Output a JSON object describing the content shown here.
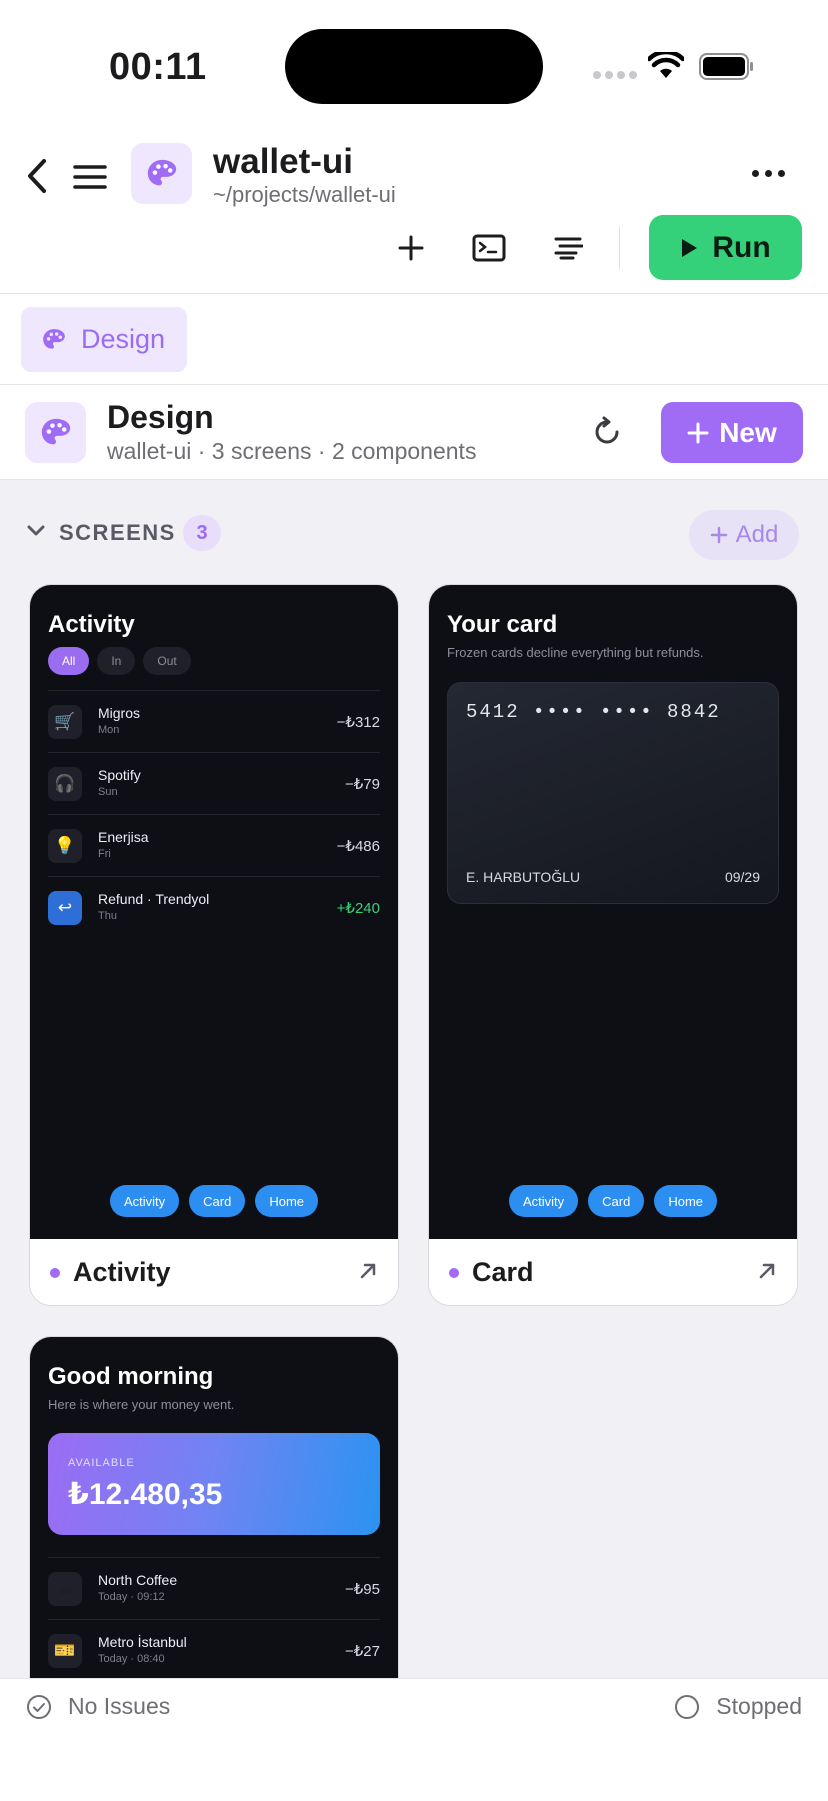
{
  "status_bar": {
    "time": "00:11"
  },
  "header": {
    "project_name": "wallet-ui",
    "project_path": "~/projects/wallet-ui",
    "run_label": "Run"
  },
  "tabs": [
    {
      "label": "Design",
      "active": true
    }
  ],
  "design": {
    "title": "Design",
    "subtitle": "wallet-ui · 3 screens · 2 components",
    "new_label": "New"
  },
  "screens": {
    "title": "SCREENS",
    "count": "3",
    "add_label": "Add",
    "activity": {
      "preview_title": "Activity",
      "filters": [
        "All",
        "In",
        "Out"
      ],
      "transactions": [
        {
          "icon": "🛒",
          "icon_name": "cart-icon",
          "name": "Migros",
          "day": "Mon",
          "amount": "−₺312",
          "positive": false
        },
        {
          "icon": "🎧",
          "icon_name": "headphones-icon",
          "name": "Spotify",
          "day": "Sun",
          "amount": "−₺79",
          "positive": false
        },
        {
          "icon": "💡",
          "icon_name": "lightbulb-icon",
          "name": "Enerjisa",
          "day": "Fri",
          "amount": "−₺486",
          "positive": false
        },
        {
          "icon": "↩",
          "icon_name": "refund-icon",
          "name": "Refund · Trendyol",
          "day": "Thu",
          "amount": "+₺240",
          "positive": true
        }
      ],
      "nav": [
        "Activity",
        "Card",
        "Home"
      ],
      "label": "Activity"
    },
    "card": {
      "preview_title": "Your card",
      "preview_subtitle": "Frozen cards decline everything but refunds.",
      "card_number": "5412 •••• •••• 8842",
      "holder": "E. HARBUTOĞLU",
      "expiry": "09/29",
      "nav": [
        "Activity",
        "Card",
        "Home"
      ],
      "label": "Card"
    },
    "home": {
      "preview_title": "Good morning",
      "preview_subtitle": "Here is where your money went.",
      "balance_label": "AVAILABLE",
      "balance_value": "₺12.480,35",
      "transactions": [
        {
          "icon": "☕",
          "icon_name": "coffee-icon",
          "name": "North Coffee",
          "day": "Today · 09:12",
          "amount": "−₺95",
          "positive": false
        },
        {
          "icon": "🎫",
          "icon_name": "ticket-icon",
          "name": "Metro İstanbul",
          "day": "Today · 08:40",
          "amount": "−₺27",
          "positive": false
        }
      ]
    }
  },
  "bottom_bar": {
    "issues": "No Issues",
    "state": "Stopped"
  },
  "colors": {
    "accent": "#a06cf5",
    "run": "#34d17a",
    "preview_bg": "#0e0f15",
    "pill": "#2b8ef0"
  }
}
